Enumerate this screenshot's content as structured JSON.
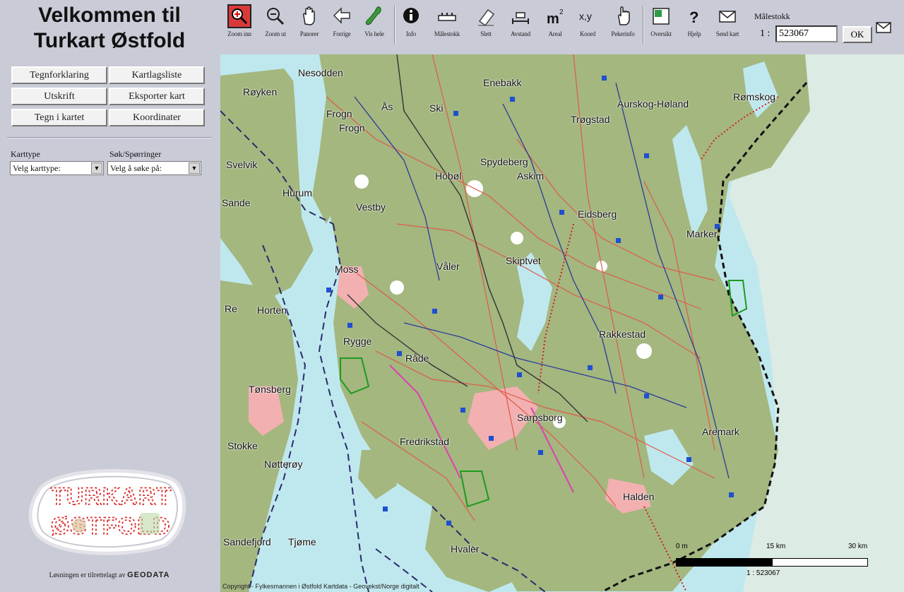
{
  "app": {
    "title_line1": "Velkommen til",
    "title_line2": "Turkart Østfold"
  },
  "left_buttons": [
    {
      "label": "Tegnforklaring"
    },
    {
      "label": "Kartlagsliste"
    },
    {
      "label": "Utskrift"
    },
    {
      "label": "Eksporter kart"
    },
    {
      "label": "Tegn i kartet"
    },
    {
      "label": "Koordinater"
    }
  ],
  "selectors": {
    "karttype_label": "Karttype",
    "karttype_value": "Velg karttype:",
    "sok_label": "Søk/Spørringer",
    "sok_value": "Velg å søke på:"
  },
  "logo": {
    "text_line1": "TURKART",
    "text_line2": "ØSTFOLD"
  },
  "credit": {
    "text": "Løsningen er tilrettelagt av",
    "brand": "GEODATA"
  },
  "toolbar": [
    {
      "label": "Zoom inn",
      "icon": "zoom-in-icon"
    },
    {
      "label": "Zoom ut",
      "icon": "zoom-out-icon"
    },
    {
      "label": "Panorer",
      "icon": "pan-hand-icon"
    },
    {
      "label": "Forrige",
      "icon": "back-arrow-icon"
    },
    {
      "label": "Vis hele",
      "icon": "full-extent-icon"
    },
    {
      "label": "Info",
      "icon": "info-icon"
    },
    {
      "label": "Målestokk",
      "icon": "scale-ruler-icon"
    },
    {
      "label": "Slett",
      "icon": "eraser-icon"
    },
    {
      "label": "Avstand",
      "icon": "distance-icon"
    },
    {
      "label": "Areal",
      "icon": "area-icon"
    },
    {
      "label": "Koord",
      "icon": "coordinate-icon"
    },
    {
      "label": "Pekerinfo",
      "icon": "pointer-info-icon"
    },
    {
      "label": "Oversikt",
      "icon": "overview-icon"
    },
    {
      "label": "Hjelp",
      "icon": "help-icon"
    },
    {
      "label": "Send kart",
      "icon": "mail-icon"
    }
  ],
  "scale": {
    "title": "Målestokk",
    "prefix": "1 :",
    "value": "523067",
    "ok_label": "OK"
  },
  "map": {
    "places": [
      {
        "name": "Nesodden"
      },
      {
        "name": "Røyken"
      },
      {
        "name": "Frogn"
      },
      {
        "name": "Frogn"
      },
      {
        "name": "Ås"
      },
      {
        "name": "Ski"
      },
      {
        "name": "Enebakk"
      },
      {
        "name": "Aurskog-Høland"
      },
      {
        "name": "Rømskog"
      },
      {
        "name": "Trøgstad"
      },
      {
        "name": "Spydeberg"
      },
      {
        "name": "Askim"
      },
      {
        "name": "Hobøl"
      },
      {
        "name": "Svelvik"
      },
      {
        "name": "Hurum"
      },
      {
        "name": "Sande"
      },
      {
        "name": "Vestby"
      },
      {
        "name": "Eidsberg"
      },
      {
        "name": "Marker"
      },
      {
        "name": "Moss"
      },
      {
        "name": "Våler"
      },
      {
        "name": "Skiptvet"
      },
      {
        "name": "Re"
      },
      {
        "name": "Horten"
      },
      {
        "name": "Rakkestad"
      },
      {
        "name": "Rygge"
      },
      {
        "name": "Råde"
      },
      {
        "name": "Tønsberg"
      },
      {
        "name": "Sarpsborg"
      },
      {
        "name": "Aremark"
      },
      {
        "name": "Stokke"
      },
      {
        "name": "Fredrikstad"
      },
      {
        "name": "Nøtterøy"
      },
      {
        "name": "Halden"
      },
      {
        "name": "Sandefjord"
      },
      {
        "name": "Tjøme"
      },
      {
        "name": "Hvaler"
      }
    ],
    "copyright": "Copyright - Fylkesmannen i Østfold  Kartdata - Geovekst/Norge digitalt",
    "scalebar": {
      "t0": "0 m",
      "t1": "15 km",
      "t2": "30 km",
      "value": "1 : 523067"
    }
  },
  "colors": {
    "land": "#a3b77f",
    "water": "#bfe8ee",
    "urban": "#f2b0b0",
    "outside": "#dcebe3",
    "roads": "#e05a4a"
  }
}
